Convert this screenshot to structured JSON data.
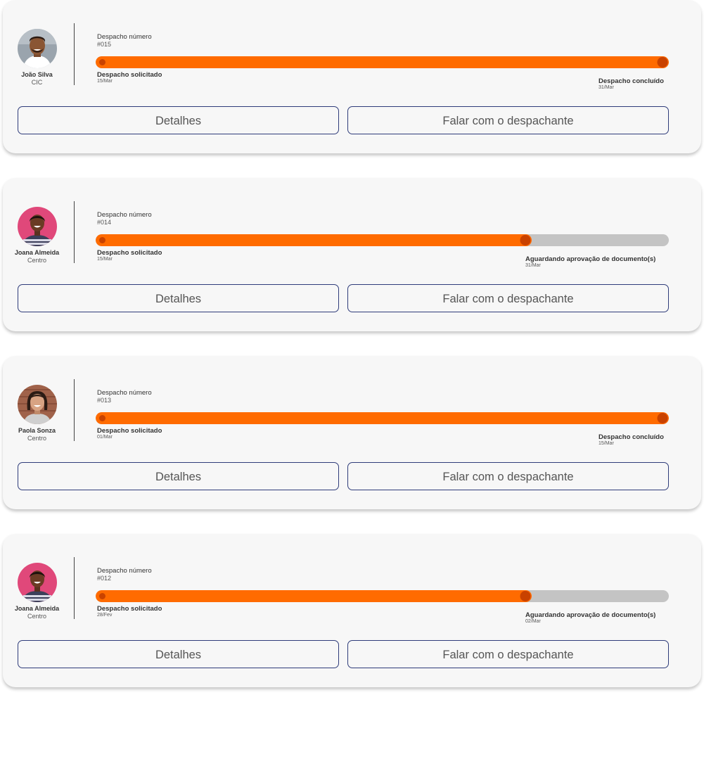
{
  "colors": {
    "progress_fill": "#ff6b00",
    "progress_dot": "#c94200",
    "progress_track": "#c4c4c4",
    "button_border": "#2f3c7a",
    "card_background": "#f7f7f7"
  },
  "shipments": [
    {
      "person": {
        "name": "João Silva",
        "location": "CIC",
        "avatar": "man-portrait"
      },
      "number_label": "Despacho número",
      "number": "#015",
      "progress": 1.0,
      "start": {
        "label": "Despacho solicitado",
        "date": "15/Mar"
      },
      "end": {
        "label": "Despacho concluído",
        "date": "31/Mar"
      },
      "buttons": {
        "details": "Detalhes",
        "contact": "Falar com o despachante"
      }
    },
    {
      "person": {
        "name": "Joana Almeida",
        "location": "Centro",
        "avatar": "woman-portrait-pink"
      },
      "number_label": "Despacho número",
      "number": "#014",
      "progress": 0.75,
      "start": {
        "label": "Despacho solicitado",
        "date": "15/Mar"
      },
      "end": {
        "label": "Aguardando aprovação de documento(s)",
        "date": "31/Mar"
      },
      "buttons": {
        "details": "Detalhes",
        "contact": "Falar com o despachante"
      }
    },
    {
      "person": {
        "name": "Paola Sonza",
        "location": "Centro",
        "avatar": "woman-portrait-brick"
      },
      "number_label": "Despacho número",
      "number": "#013",
      "progress": 1.0,
      "start": {
        "label": "Despacho solicitado",
        "date": "01/Mar"
      },
      "end": {
        "label": "Despacho concluído",
        "date": "15/Mar"
      },
      "buttons": {
        "details": "Detalhes",
        "contact": "Falar com o despachante"
      }
    },
    {
      "person": {
        "name": "Joana Almeida",
        "location": "Centro",
        "avatar": "woman-portrait-pink"
      },
      "number_label": "Despacho número",
      "number": "#012",
      "progress": 0.75,
      "start": {
        "label": "Despacho solicitado",
        "date": "28/Fev"
      },
      "end": {
        "label": "Aguardando aprovação de documento(s)",
        "date": "02/Mar"
      },
      "buttons": {
        "details": "Detalhes",
        "contact": "Falar com o despachante"
      }
    }
  ]
}
